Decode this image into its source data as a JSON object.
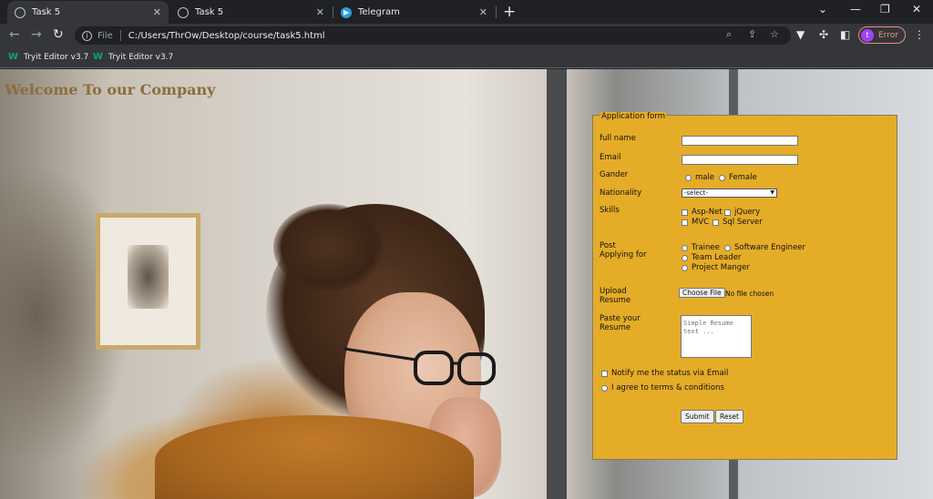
{
  "browser": {
    "tabs": [
      {
        "title": "Task 5",
        "icon": "globe-icon",
        "active": true
      },
      {
        "title": "Task 5",
        "icon": "globe-icon",
        "active": false
      },
      {
        "title": "Telegram",
        "icon": "telegram-icon",
        "active": false
      }
    ],
    "tab_close": "✕",
    "new_tab": "+",
    "url_scheme": "File",
    "url": "C:/Users/ThrOw/Desktop/course/task5.html",
    "profile_initial": "t",
    "profile_status": "Error",
    "bookmarks": [
      {
        "label": "Tryit Editor v3.7"
      },
      {
        "label": "Tryit Editor v3.7"
      }
    ]
  },
  "page": {
    "heading": "Welcome To our Company",
    "form": {
      "legend": "Application form",
      "full_name_label": "full name",
      "email_label": "Email",
      "gender_label": "Gander",
      "gender_options": [
        "male",
        "Female"
      ],
      "nationality_label": "Nationality",
      "nationality_selected": "-select-",
      "skills_label": "Skills",
      "skills": [
        "Asp-Net",
        "jQuery",
        "MVC",
        "Sql Server"
      ],
      "post_label_1": "Post",
      "post_label_2": "Applying for",
      "posts": [
        "Trainee",
        "Software Engineer",
        "Team Leader",
        "Project Manger"
      ],
      "upload_label_1": "Upload",
      "upload_label_2": "Resume",
      "choose_file": "Choose File",
      "no_file": "No file chosen",
      "paste_label_1": "Paste your",
      "paste_label_2": "Resume",
      "resume_placeholder": "Simple Resume text ...",
      "notify_label": "Notify me the status via Email",
      "terms_label": "I agree to terms & conditions",
      "submit": "Submit",
      "reset": "Reset"
    }
  },
  "colors": {
    "form_background": "#e5ac28",
    "heading": "#8b6d3e"
  }
}
